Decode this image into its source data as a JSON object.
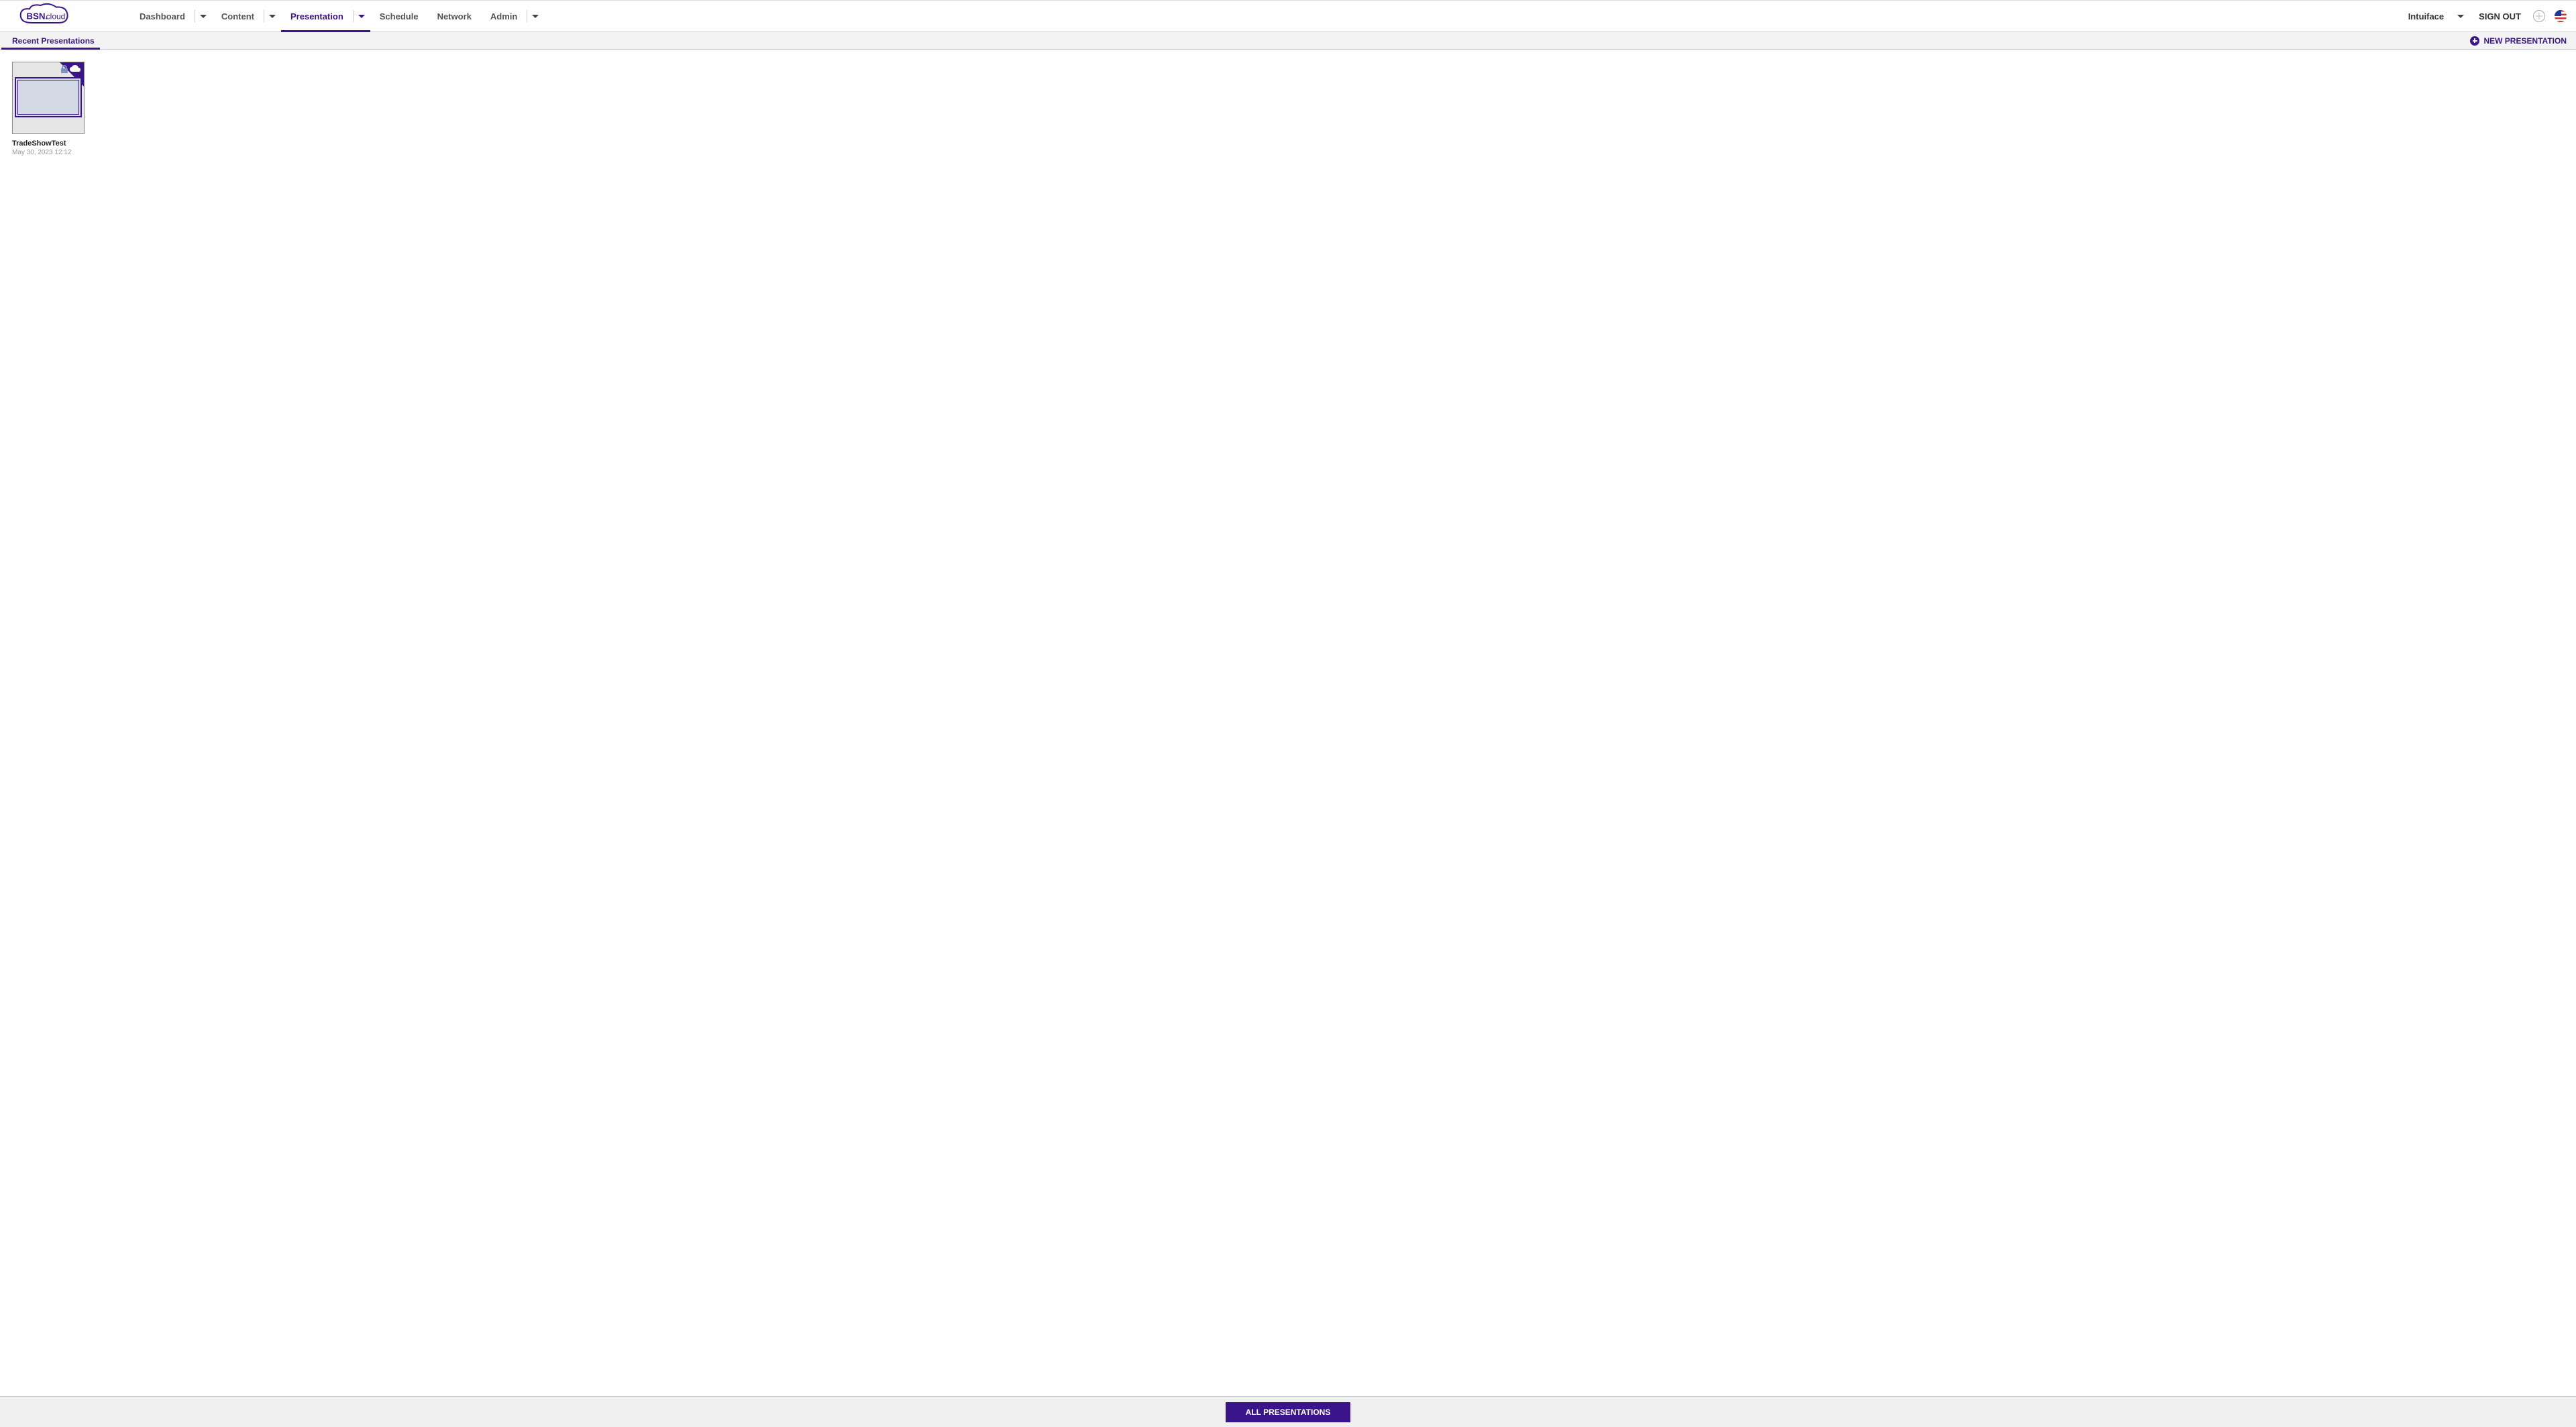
{
  "brand": {
    "name_bold": "BSN.",
    "name_light": "cloud"
  },
  "nav": {
    "items": [
      {
        "label": "Dashboard",
        "dropdown": true,
        "active": false
      },
      {
        "label": "Content",
        "dropdown": true,
        "active": false
      },
      {
        "label": "Presentation",
        "dropdown": true,
        "active": true
      },
      {
        "label": "Schedule",
        "dropdown": false,
        "active": false
      },
      {
        "label": "Network",
        "dropdown": false,
        "active": false
      },
      {
        "label": "Admin",
        "dropdown": true,
        "active": false
      }
    ]
  },
  "header_right": {
    "account_name": "Intuiface",
    "signout_label": "SIGN OUT"
  },
  "sub_header": {
    "tab_label": "Recent Presentations",
    "new_button_label": "NEW PRESENTATION"
  },
  "presentations": [
    {
      "title": "TradeShowTest",
      "date": "May 30, 2023 12:12"
    }
  ],
  "footer": {
    "all_button_label": "ALL PRESENTATIONS"
  }
}
